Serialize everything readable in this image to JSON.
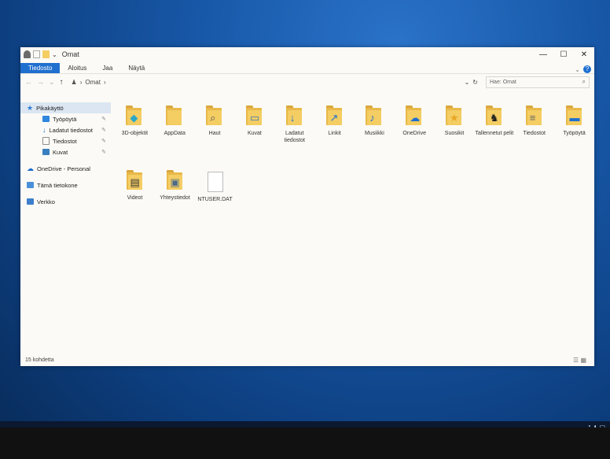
{
  "window": {
    "title": "Omat"
  },
  "ribbon": {
    "tabs": [
      "Tiedosto",
      "Aloitus",
      "Jaa",
      "Näytä"
    ],
    "help": "?"
  },
  "address": {
    "path": "Omat",
    "search_placeholder": "Hae: Omat"
  },
  "sidebar": {
    "items": [
      {
        "label": "Pikakäyttö",
        "icon": "star-icon",
        "color": "#2b7bd6"
      },
      {
        "label": "Työpöytä",
        "icon": "desktop-icon",
        "color": "#2e86de"
      },
      {
        "label": "Ladatut tiedostot",
        "icon": "download-icon",
        "color": "#1f6fcf"
      },
      {
        "label": "Tiedostot",
        "icon": "document-icon",
        "color": "#8d8d8d"
      },
      {
        "label": "Kuvat",
        "icon": "pictures-icon",
        "color": "#3a7fbf"
      },
      {
        "label": "OneDrive - Personal",
        "icon": "onedrive-icon",
        "color": "#1f6fcf"
      },
      {
        "label": "Tämä tietokone",
        "icon": "computer-icon",
        "color": "#4a90d9"
      },
      {
        "label": "Verkko",
        "icon": "network-icon",
        "color": "#3d7fcc"
      }
    ]
  },
  "items_row1": [
    {
      "label": "3D-objektit",
      "glyph": "◆",
      "color": "#2aa8c7"
    },
    {
      "label": "AppData",
      "glyph": "",
      "color": "#000"
    },
    {
      "label": "Haut",
      "glyph": "⌕",
      "color": "#555"
    },
    {
      "label": "Kuvat",
      "glyph": "▭",
      "color": "#3b78b5"
    },
    {
      "label": "Ladatut tiedostot",
      "glyph": "↓",
      "color": "#1f6fcf"
    },
    {
      "label": "Linkit",
      "glyph": "↗",
      "color": "#1f6fcf"
    },
    {
      "label": "Musiikki",
      "glyph": "♪",
      "color": "#1f6fcf"
    },
    {
      "label": "OneDrive",
      "glyph": "☁",
      "color": "#1f6fcf"
    },
    {
      "label": "Suosikit",
      "glyph": "★",
      "color": "#e8a623"
    },
    {
      "label": "Tallennetut pelit",
      "glyph": "♞",
      "color": "#222"
    },
    {
      "label": "Tiedostot",
      "glyph": "≡",
      "color": "#666"
    },
    {
      "label": "Työpöytä",
      "glyph": "▬",
      "color": "#1f6fcf"
    }
  ],
  "items_row2": [
    {
      "label": "Videot",
      "glyph": "▤",
      "color": "#333"
    },
    {
      "label": "Yhteystiedot",
      "glyph": "▣",
      "color": "#4a6b8a"
    },
    {
      "label": "NTUSER.DAT",
      "glyph": "",
      "color": "#000"
    }
  ],
  "status": {
    "count": "15 kohdetta"
  }
}
